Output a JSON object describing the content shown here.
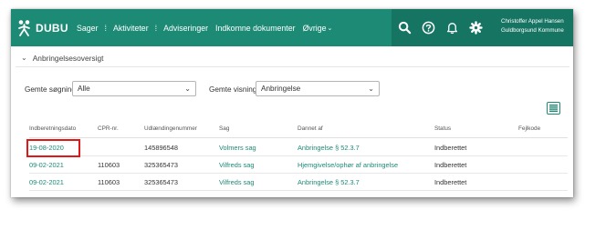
{
  "app": {
    "name": "DUBU"
  },
  "nav": {
    "items": [
      {
        "label": "Sager"
      },
      {
        "label": "Aktiviteter"
      },
      {
        "label": "Adviseringer"
      },
      {
        "label": "Indkomne dokumenter"
      },
      {
        "label": "Øvrige"
      }
    ]
  },
  "user": {
    "name": "Christoffer Appel Hansen",
    "org": "Guldborgsund Kommune"
  },
  "panel": {
    "title": "Anbringelsesoversigt"
  },
  "filters": {
    "saved_search_label": "Gemte søgning",
    "saved_search_value": "Alle",
    "saved_view_label": "Gemte visninger",
    "saved_view_value": "Anbringelse"
  },
  "table": {
    "columns": [
      "Indberetningsdato",
      "CPR-nr.",
      "Udlændingenummer",
      "Sag",
      "Dannet af",
      "Status",
      "Fejlkode"
    ],
    "rows": [
      [
        "19-08-2020",
        "",
        "145896548",
        "Volmers sag",
        "Anbringelse § 52.3.7",
        "Indberettet",
        ""
      ],
      [
        "09-02-2021",
        "110603",
        "325365473",
        "Vilfreds sag",
        "Hjemgivelse/ophør af anbringelse",
        "Indberettet",
        ""
      ],
      [
        "09-02-2021",
        "110603",
        "325365473",
        "Vilfreds sag",
        "Anbringelse § 52.3.7",
        "Indberettet",
        ""
      ]
    ]
  },
  "colors": {
    "header": "#1d8a76",
    "header_dark": "#167462",
    "link": "#1d8a76",
    "highlight": "#e01818"
  },
  "icons": [
    "search-icon",
    "help-icon",
    "bell-icon",
    "gear-icon",
    "list-view-icon",
    "chevron-down-icon"
  ]
}
